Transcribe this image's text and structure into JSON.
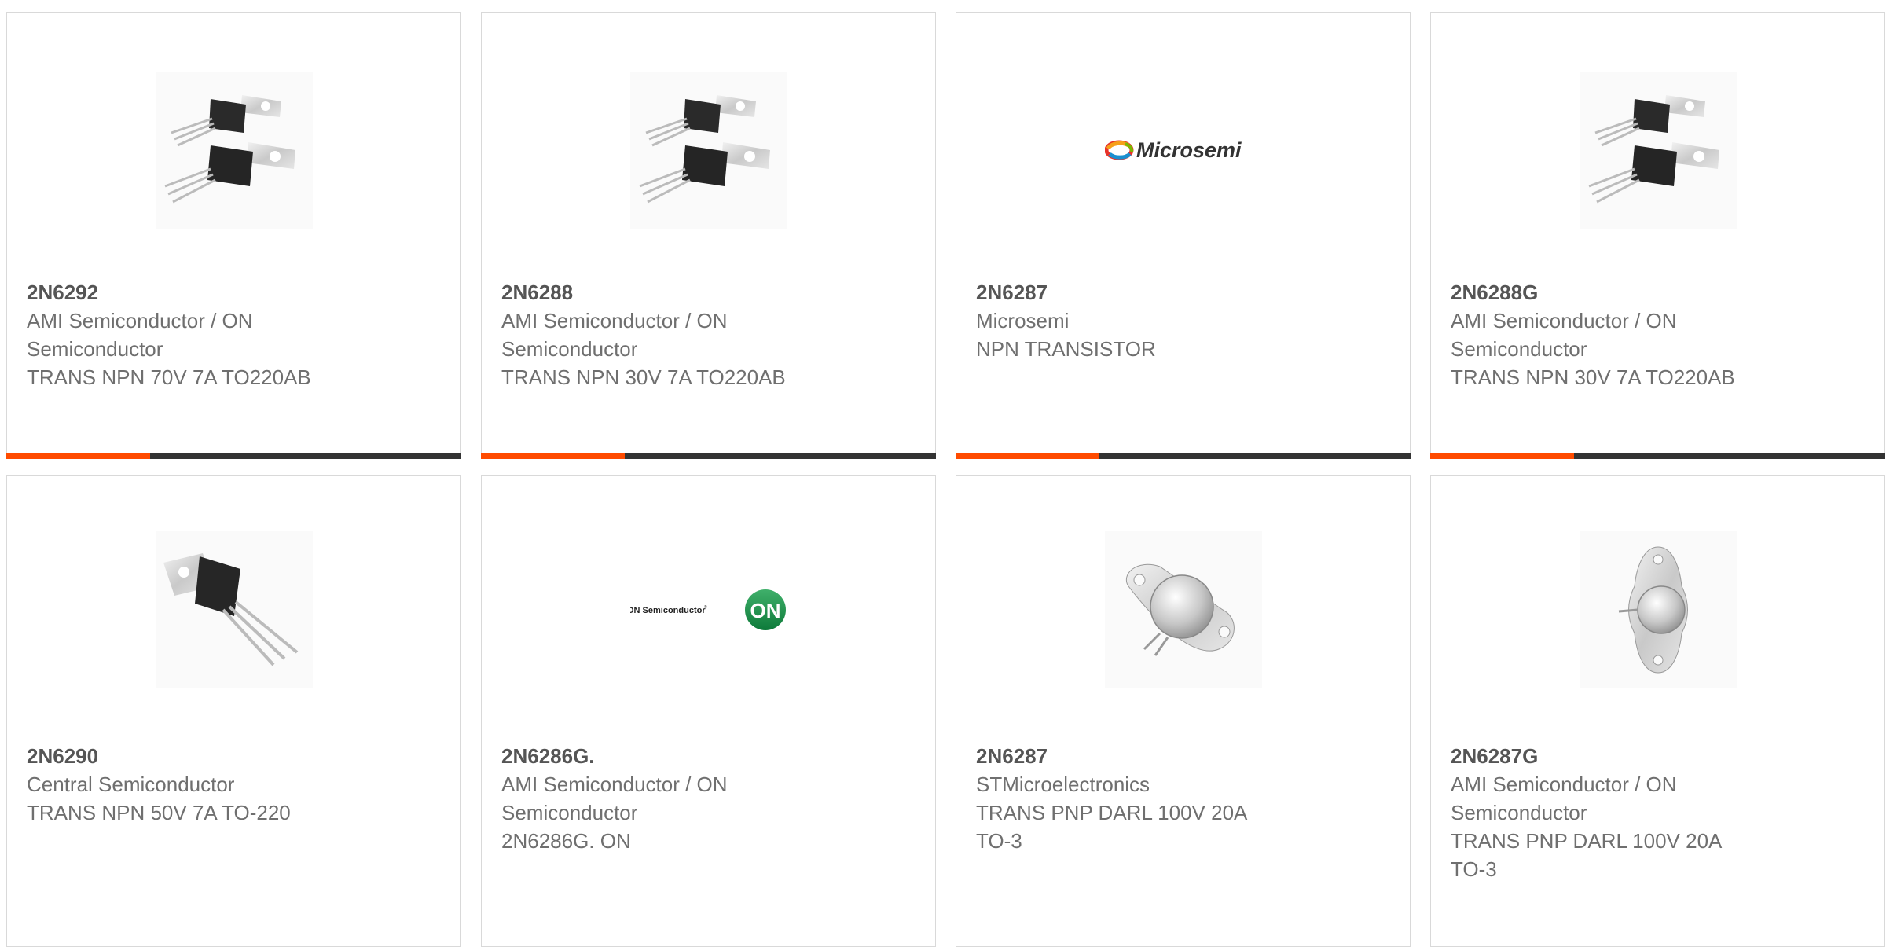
{
  "accent_color": "#ff4b00",
  "bar_color": "#333333",
  "products": [
    {
      "part": "2N6292",
      "manufacturer": "AMI Semiconductor / ON Semiconductor",
      "description": "TRANS NPN 70V 7A TO220AB",
      "image": "to220-pair-image"
    },
    {
      "part": "2N6288",
      "manufacturer": "AMI Semiconductor / ON Semiconductor",
      "description": "TRANS NPN 30V 7A TO220AB",
      "image": "to220-pair-image"
    },
    {
      "part": "2N6287",
      "manufacturer": "Microsemi",
      "description": "NPN TRANSISTOR",
      "image": "microsemi-logo"
    },
    {
      "part": "2N6288G",
      "manufacturer": "AMI Semiconductor / ON Semiconductor",
      "description": "TRANS NPN 30V 7A TO220AB",
      "image": "to220-pair-image"
    },
    {
      "part": "2N6290",
      "manufacturer": "Central Semiconductor",
      "description": "TRANS NPN 50V 7A TO-220",
      "image": "to220-single-image"
    },
    {
      "part": "2N6286G.",
      "manufacturer": "AMI Semiconductor / ON Semiconductor",
      "description": "2N6286G. ON",
      "image": "on-semiconductor-logo"
    },
    {
      "part": "2N6287",
      "manufacturer": "STMicroelectronics",
      "description": "TRANS PNP DARL 100V 20A TO-3",
      "image": "to3-package-image"
    },
    {
      "part": "2N6287G",
      "manufacturer": "AMI Semiconductor / ON Semiconductor",
      "description": "TRANS PNP DARL 100V 20A TO-3",
      "image": "to3-package-side-image"
    }
  ],
  "logos": {
    "microsemi": "Microsemi",
    "on_text": "ON Semiconductor",
    "on_mark": "ON"
  }
}
